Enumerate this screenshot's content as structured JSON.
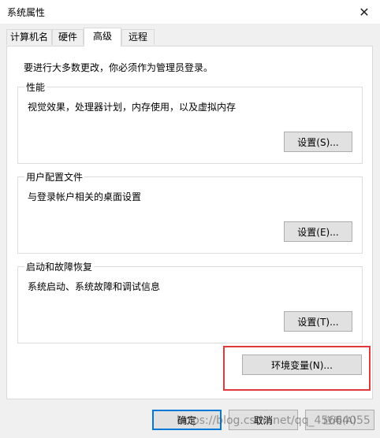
{
  "window": {
    "title": "系统属性",
    "close_glyph": "✕"
  },
  "tabs": [
    {
      "label": "计算机名",
      "active": false
    },
    {
      "label": "硬件",
      "active": false
    },
    {
      "label": "高级",
      "active": true
    },
    {
      "label": "远程",
      "active": false
    }
  ],
  "advanced": {
    "notice": "要进行大多数更改，你必须作为管理员登录。",
    "performance": {
      "title": "性能",
      "desc": "视觉效果，处理器计划，内存使用，以及虚拟内存",
      "button": "设置(S)..."
    },
    "user_profiles": {
      "title": "用户配置文件",
      "desc": "与登录帐户相关的桌面设置",
      "button": "设置(E)..."
    },
    "startup_recovery": {
      "title": "启动和故障恢复",
      "desc": "系统启动、系统故障和调试信息",
      "button": "设置(T)..."
    },
    "env_vars_button": "环境变量(N)..."
  },
  "footer": {
    "ok": "确定",
    "cancel": "取消",
    "apply": "应用(A)"
  },
  "watermark": "https://blog.csdn.net/qq_45664055",
  "colors": {
    "highlight": "#e0383c",
    "default_button_border": "#0078d7"
  }
}
